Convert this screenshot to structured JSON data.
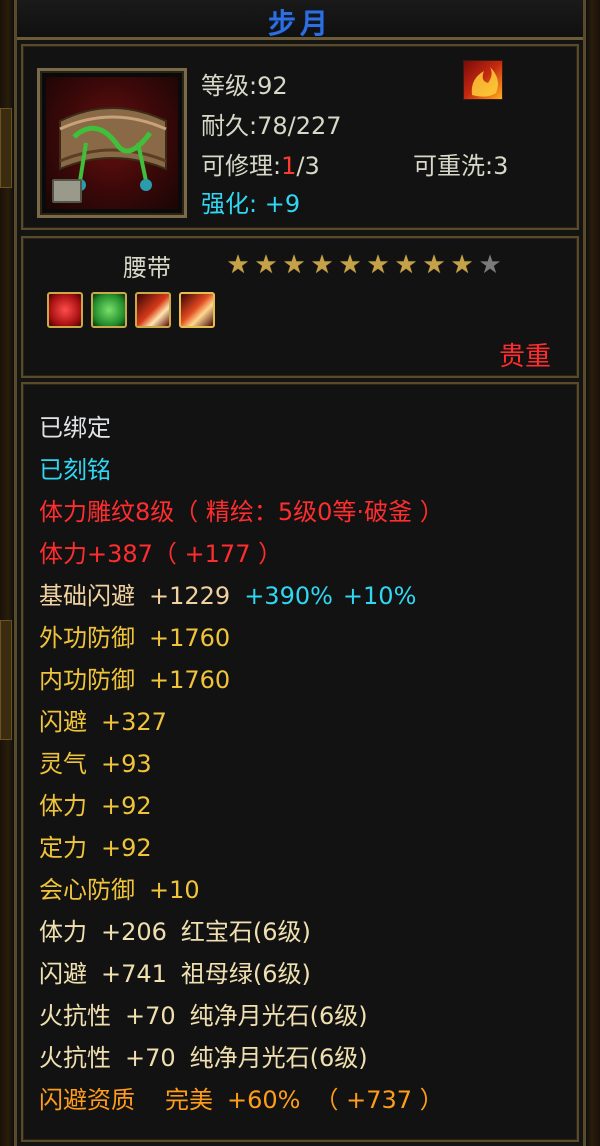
{
  "title": "步月",
  "stats": {
    "level_label": "等级",
    "level_value": ":92",
    "durability_label": "耐久",
    "durability_value": ":78/227",
    "repair_label": "可修理",
    "repair_current": "1",
    "repair_total": "/3",
    "rewash_label": "可重洗",
    "rewash_value": ":3",
    "enhance_label": "强化",
    "enhance_value": ": +9"
  },
  "item": {
    "type": "腰带",
    "stars_total": 9,
    "stars_filled": 9,
    "quality": "贵重",
    "gems": [
      "ruby-gem-icon",
      "emerald-gem-icon",
      "moonstone-gem-icon",
      "moonstone-gem-icon"
    ]
  },
  "lines": [
    {
      "segments": [
        "已绑定"
      ],
      "color": "white"
    },
    {
      "segments": [
        "已刻铭"
      ],
      "color": "cyan"
    },
    {
      "segments": [
        "体力雕纹8级（ 精绘：5级0等·破釜 ）"
      ],
      "color": "red"
    },
    {
      "segments": [
        "体力+387（ +177 ）"
      ],
      "color": "red"
    },
    {
      "segments": [
        "基础闪避",
        "+1229",
        "+390%",
        "+10%"
      ],
      "color": "mixed"
    },
    {
      "segments": [
        "外功防御",
        "+1760"
      ],
      "color": "gold"
    },
    {
      "segments": [
        "内功防御",
        "+1760"
      ],
      "color": "gold"
    },
    {
      "segments": [
        "闪避",
        "+327"
      ],
      "color": "gold"
    },
    {
      "segments": [
        "灵气",
        "+93"
      ],
      "color": "gold"
    },
    {
      "segments": [
        "体力",
        "+92"
      ],
      "color": "gold"
    },
    {
      "segments": [
        "定力",
        "+92"
      ],
      "color": "gold"
    },
    {
      "segments": [
        "会心防御",
        "+10"
      ],
      "color": "gold"
    },
    {
      "segments": [
        "体力",
        "+206",
        "红宝石(6级)"
      ],
      "color": "white"
    },
    {
      "segments": [
        "闪避",
        "+741",
        "祖母绿(6级)"
      ],
      "color": "white"
    },
    {
      "segments": [
        "火抗性",
        "+70",
        "纯净月光石(6级)"
      ],
      "color": "white"
    },
    {
      "segments": [
        "火抗性",
        "+70",
        "纯净月光石(6级)"
      ],
      "color": "white"
    },
    {
      "segments": [
        "闪避资质",
        "完美",
        "+60%",
        "（ +737 ）"
      ],
      "color": "orange"
    }
  ],
  "colors": {
    "title_blue": "#2d6fe0",
    "border_gold": "#5a4a2c",
    "text_white": "#e0e4e6",
    "text_cyan": "#2fd7f2",
    "text_red": "#ff2d2d",
    "text_gold": "#f0c43a",
    "text_orange": "#ff9c1a"
  }
}
